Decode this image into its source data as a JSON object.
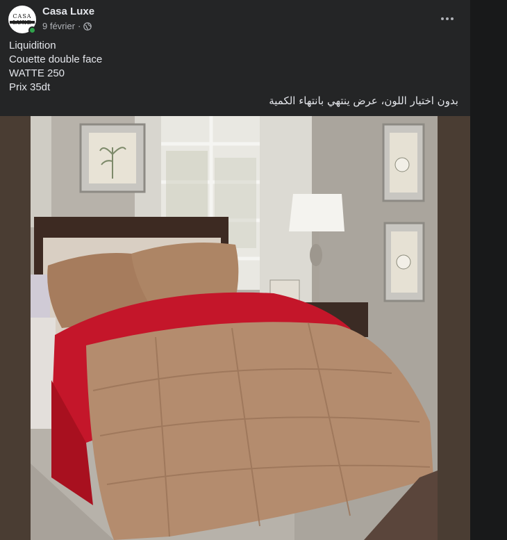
{
  "post": {
    "page_name": "Casa Luxe",
    "avatar_text": "CASA LUXE",
    "date": "9 février",
    "separator": "·",
    "lines": [
      "Liquidition",
      "Couette double face",
      "WATTE 250",
      "Prix 35dt"
    ],
    "arabic_text": "بدون اختيار اللون، عرض ينتهي بانتهاء الكمية"
  },
  "icons": {
    "privacy": "globe-icon",
    "menu": "more-options-icon"
  },
  "colors": {
    "post_bg": "#242526",
    "media_bg": "#4a3d33",
    "comforter_tan": "#b48c6e",
    "comforter_red": "#c4162a"
  }
}
